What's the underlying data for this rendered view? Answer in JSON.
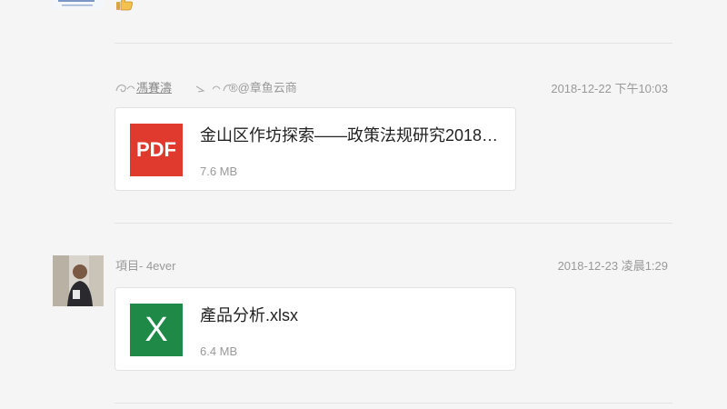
{
  "colors": {
    "background": "#f5f5f5",
    "pdf": "#e03a2f",
    "excel": "#1f8a48",
    "muted": "#999999"
  },
  "top_message": {
    "reaction_icon": "thumbs-up-icon"
  },
  "messages": [
    {
      "sender": "®@章鱼云商",
      "sender_decor": "馮賽濤",
      "time": "2018-12-22 下午10:03",
      "file": {
        "type_label": "PDF",
        "icon": "pdf-icon",
        "name": "金山区作坊探索——政策法规研究20181...",
        "size": "7.6 MB"
      }
    },
    {
      "sender": "項目- 4ever",
      "time": "2018-12-23 凌晨1:29",
      "file": {
        "type_label": "X",
        "icon": "excel-icon",
        "name": "產品分析.xlsx",
        "size": "6.4 MB"
      }
    }
  ]
}
